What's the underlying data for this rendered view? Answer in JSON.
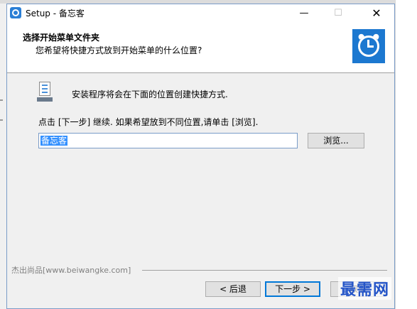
{
  "window": {
    "title": "Setup - 备忘客",
    "controls": {
      "minimize": "—",
      "maximize": "☐",
      "close": "✕"
    }
  },
  "header": {
    "title": "选择开始菜单文件夹",
    "subtitle": "您希望将快捷方式放到开始菜单的什么位置?",
    "logo_icon": "alarm-clock-icon"
  },
  "main": {
    "info": "安装程序将会在下面的位置创建快捷方式.",
    "instructions": "点击 [下一步] 继续. 如果希望放到不同位置,请单击 [浏览].",
    "folder_value": "备忘客",
    "browse_label": "浏览..."
  },
  "footer": {
    "brand": "杰出尚品[www.beiwangke.com]",
    "back_label": "< 后退",
    "next_label": "下一步 >",
    "cancel_label": "取消"
  },
  "watermark": "最需网",
  "colors": {
    "accent": "#0078d7",
    "logo_bg": "#1c78d0",
    "selection": "#3390ff",
    "watermark": "#2455c8"
  }
}
